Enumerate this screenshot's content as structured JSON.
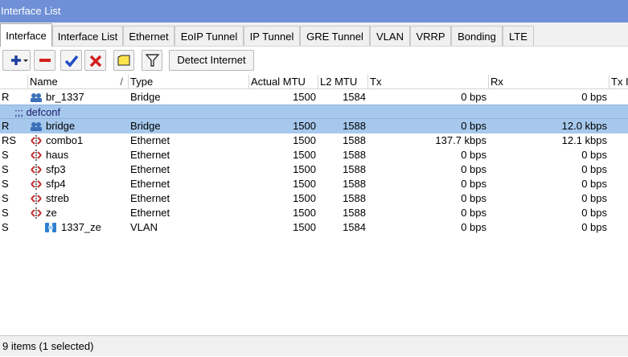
{
  "window": {
    "title": "Interface List"
  },
  "tabs": [
    {
      "label": "Interface",
      "active": true
    },
    {
      "label": "Interface List"
    },
    {
      "label": "Ethernet"
    },
    {
      "label": "EoIP Tunnel"
    },
    {
      "label": "IP Tunnel"
    },
    {
      "label": "GRE Tunnel"
    },
    {
      "label": "VLAN"
    },
    {
      "label": "VRRP"
    },
    {
      "label": "Bonding"
    },
    {
      "label": "LTE"
    }
  ],
  "toolbar": {
    "detect_label": "Detect Internet"
  },
  "columns": {
    "flag": "",
    "name": "Name",
    "name_sort": "/",
    "type": "Type",
    "actual_mtu": "Actual MTU",
    "l2_mtu": "L2 MTU",
    "tx": "Tx",
    "rx": "Rx",
    "tx_partial": "Tx I"
  },
  "rows": [
    {
      "flag": "R",
      "name": "br_1337",
      "type": "Bridge",
      "actual_mtu": "1500",
      "l2_mtu": "1584",
      "tx": "0 bps",
      "rx": "0 bps",
      "icon": "bridge-icon"
    },
    {
      "separator": ";;; defconf"
    },
    {
      "flag": "R",
      "name": "bridge",
      "type": "Bridge",
      "actual_mtu": "1500",
      "l2_mtu": "1588",
      "tx": "0 bps",
      "rx": "12.0 kbps",
      "icon": "bridge-icon",
      "selected": true
    },
    {
      "flag": "RS",
      "name": "combo1",
      "type": "Ethernet",
      "actual_mtu": "1500",
      "l2_mtu": "1588",
      "tx": "137.7 kbps",
      "rx": "12.1 kbps",
      "icon": "ethernet-icon"
    },
    {
      "flag": "S",
      "name": "haus",
      "type": "Ethernet",
      "actual_mtu": "1500",
      "l2_mtu": "1588",
      "tx": "0 bps",
      "rx": "0 bps",
      "icon": "ethernet-icon"
    },
    {
      "flag": "S",
      "name": "sfp3",
      "type": "Ethernet",
      "actual_mtu": "1500",
      "l2_mtu": "1588",
      "tx": "0 bps",
      "rx": "0 bps",
      "icon": "ethernet-icon"
    },
    {
      "flag": "S",
      "name": "sfp4",
      "type": "Ethernet",
      "actual_mtu": "1500",
      "l2_mtu": "1588",
      "tx": "0 bps",
      "rx": "0 bps",
      "icon": "ethernet-icon"
    },
    {
      "flag": "S",
      "name": "streb",
      "type": "Ethernet",
      "actual_mtu": "1500",
      "l2_mtu": "1588",
      "tx": "0 bps",
      "rx": "0 bps",
      "icon": "ethernet-icon"
    },
    {
      "flag": "S",
      "name": "ze",
      "type": "Ethernet",
      "actual_mtu": "1500",
      "l2_mtu": "1588",
      "tx": "0 bps",
      "rx": "0 bps",
      "icon": "ethernet-icon"
    },
    {
      "flag": "S",
      "name": "1337_ze",
      "type": "VLAN",
      "actual_mtu": "1500",
      "l2_mtu": "1584",
      "tx": "0 bps",
      "rx": "0 bps",
      "icon": "vlan-icon",
      "indent": true
    }
  ],
  "status": {
    "text": "9 items (1 selected)"
  },
  "colors": {
    "titlebar": "#6f90d6",
    "selected_row": "#a6c8ec",
    "add_icon": "#1f3f9f",
    "remove_icon": "#d42020",
    "check_icon": "#1f4fc4"
  }
}
